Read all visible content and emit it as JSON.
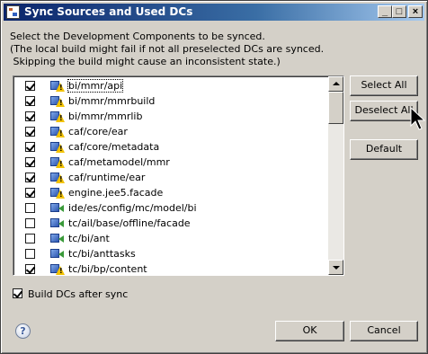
{
  "window": {
    "title": "Sync Sources and Used DCs",
    "controls": {
      "minimize": "_",
      "maximize": "□",
      "close": "×"
    }
  },
  "intro": {
    "line1": "Select the Development Components to be synced.",
    "line2": "(The local build might fail if not all preselected DCs are synced.",
    "line3": " Skipping the build might cause an inconsistent state.)"
  },
  "components": [
    {
      "name": "bi/mmr/api",
      "checked": true,
      "icon": "dc-warning-icon",
      "focused": true
    },
    {
      "name": "bi/mmr/mmrbuild",
      "checked": true,
      "icon": "dc-warning-icon"
    },
    {
      "name": "bi/mmr/mmrlib",
      "checked": true,
      "icon": "dc-warning-icon"
    },
    {
      "name": "caf/core/ear",
      "checked": true,
      "icon": "dc-warning-icon"
    },
    {
      "name": "caf/core/metadata",
      "checked": true,
      "icon": "dc-warning-icon"
    },
    {
      "name": "caf/metamodel/mmr",
      "checked": true,
      "icon": "dc-warning-icon"
    },
    {
      "name": "caf/runtime/ear",
      "checked": true,
      "icon": "dc-warning-icon"
    },
    {
      "name": "engine.jee5.facade",
      "checked": true,
      "icon": "dc-warning-icon"
    },
    {
      "name": "ide/es/config/mc/model/bi",
      "checked": false,
      "icon": "dc-used-icon"
    },
    {
      "name": "tc/ail/base/offline/facade",
      "checked": false,
      "icon": "dc-used-icon"
    },
    {
      "name": "tc/bi/ant",
      "checked": false,
      "icon": "dc-used-icon"
    },
    {
      "name": "tc/bi/anttasks",
      "checked": false,
      "icon": "dc-used-icon"
    },
    {
      "name": "tc/bi/bp/content",
      "checked": true,
      "icon": "dc-warning-icon"
    }
  ],
  "buttons": {
    "select_all": "Select All",
    "deselect_all": "Deselect All",
    "default": "Default",
    "ok": "OK",
    "cancel": "Cancel"
  },
  "build_after_sync": {
    "label": "Build DCs after sync",
    "checked": true
  },
  "help": "?"
}
